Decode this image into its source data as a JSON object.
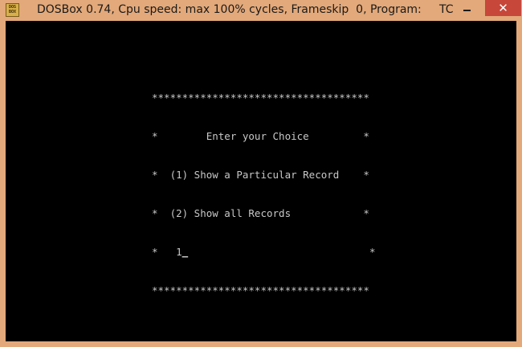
{
  "window": {
    "icon_label_top": "DOS",
    "icon_label_bottom": "BOX",
    "title": "DOSBox 0.74, Cpu speed: max 100% cycles, Frameskip  0, Program:     TC",
    "close_glyph": "✕"
  },
  "terminal": {
    "border_top": "************************************",
    "line_prompt": "*        Enter your Choice         *",
    "line_option1": "*  (1) Show a Particular Record    *",
    "line_option2": "*  (2) Show all Records            *",
    "input_prefix": "*   ",
    "input_value": "1",
    "cursor": "_",
    "input_suffix": "                              *",
    "border_bottom": "************************************"
  }
}
